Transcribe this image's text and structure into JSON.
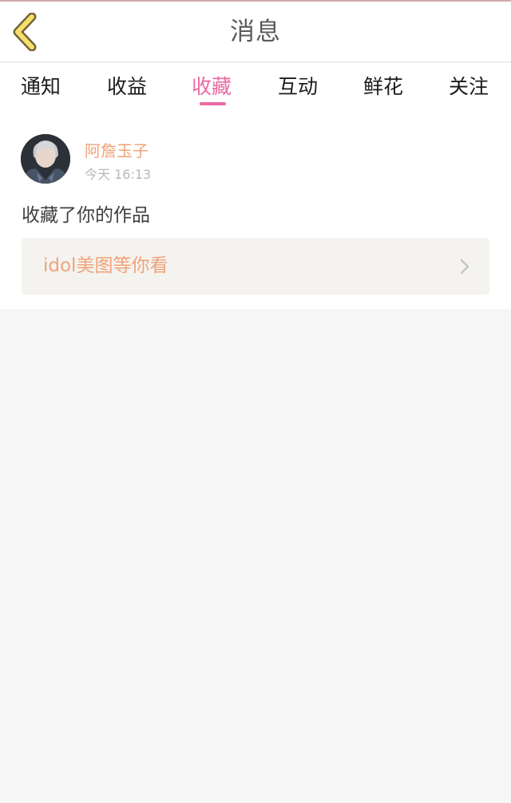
{
  "header": {
    "title": "消息",
    "back_icon": "chevron-left-icon"
  },
  "tabs": [
    {
      "label": "通知",
      "active": false
    },
    {
      "label": "收益",
      "active": false
    },
    {
      "label": "收藏",
      "active": true
    },
    {
      "label": "互动",
      "active": false
    },
    {
      "label": "鲜花",
      "active": false
    },
    {
      "label": "关注",
      "active": false
    }
  ],
  "message": {
    "username": "阿詹玉子",
    "timestamp": "今天 16:13",
    "action": "收藏了你的作品",
    "work_title": "idol美图等你看",
    "card_icon": "chevron-right-icon"
  },
  "colors": {
    "accent_pink": "#ea6aa2",
    "username_orange": "#f0a37a",
    "back_icon_fill": "#f6df6c",
    "back_icon_stroke": "#7b6a35"
  }
}
